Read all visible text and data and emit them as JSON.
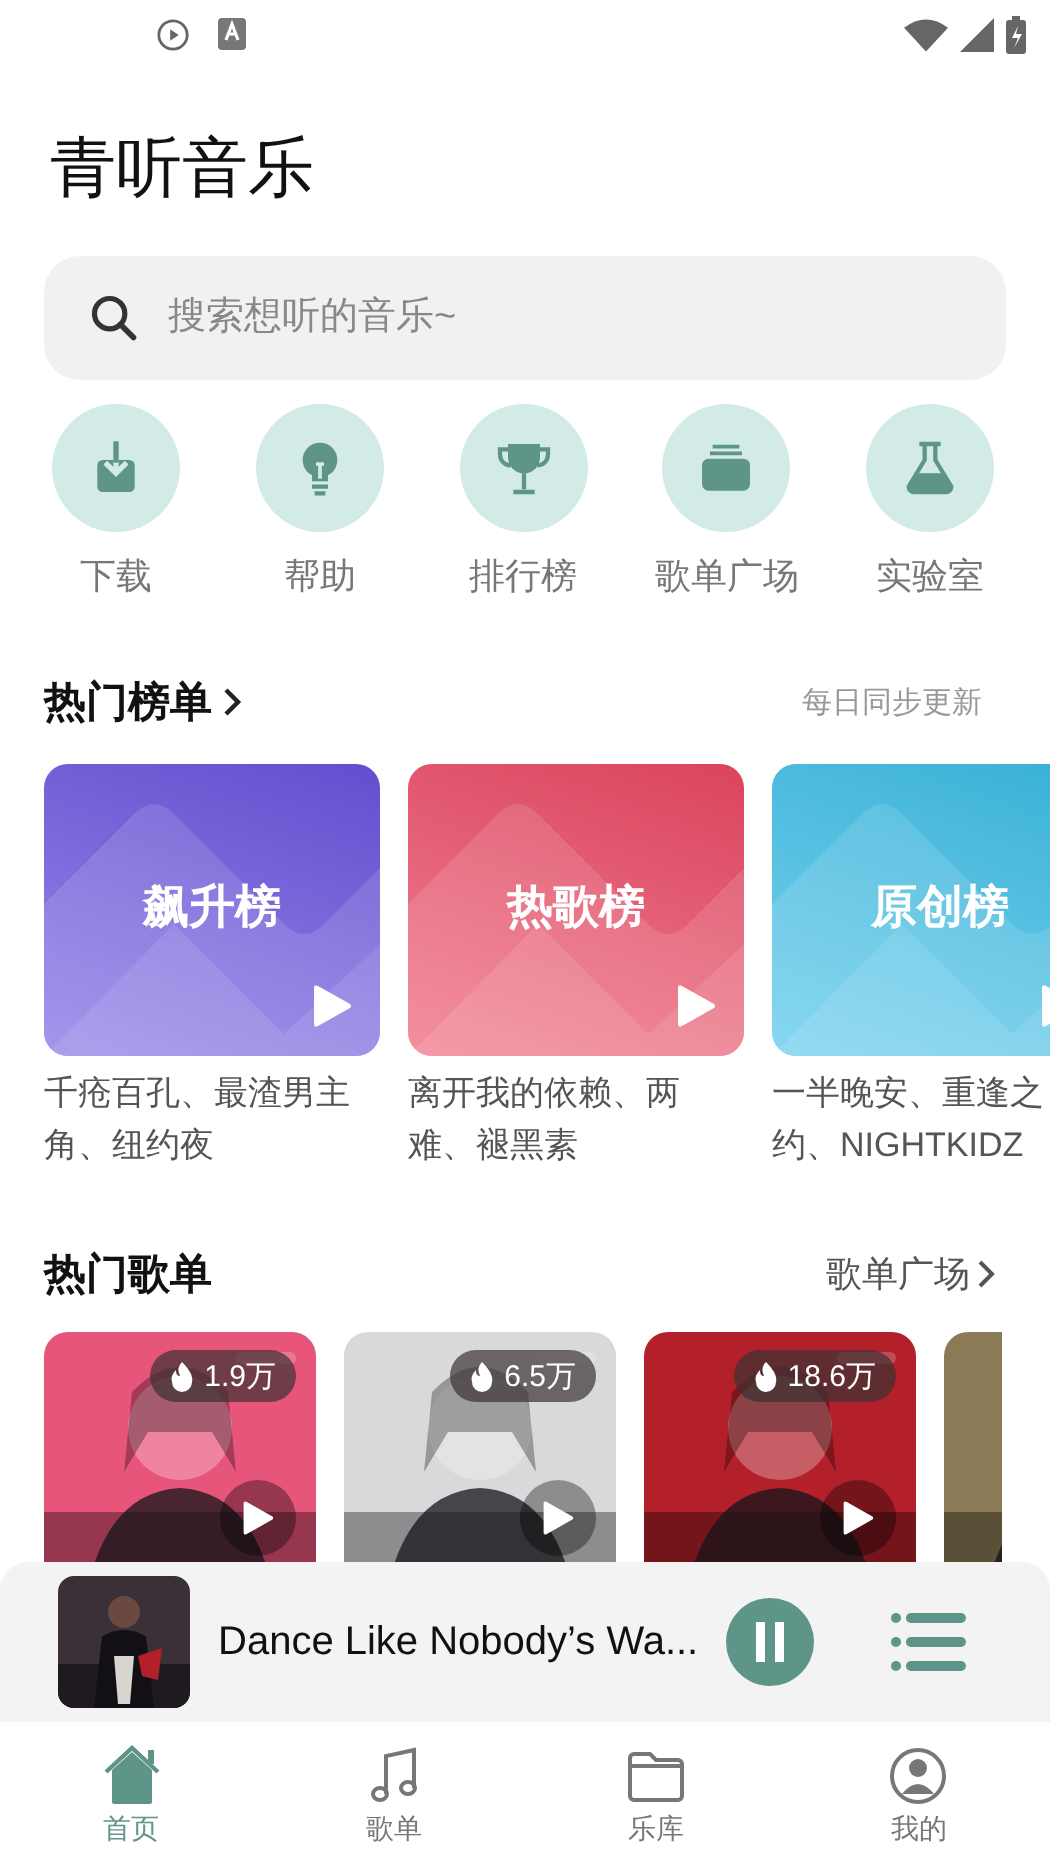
{
  "app_title": "青听音乐",
  "search": {
    "placeholder": "搜索想听的音乐~"
  },
  "shortcuts": [
    {
      "kind": "download",
      "label": "下载"
    },
    {
      "kind": "bulb",
      "label": "帮助"
    },
    {
      "kind": "trophy",
      "label": "排行榜"
    },
    {
      "kind": "stack",
      "label": "歌单广场"
    },
    {
      "kind": "flask",
      "label": "实验室"
    }
  ],
  "charts_section": {
    "title": "热门榜单",
    "note": "每日同步更新",
    "charts": [
      {
        "title": "飙升榜",
        "color": "#6a55e0",
        "tracks": "千疮百孔、最渣男主角、纽约夜"
      },
      {
        "title": "热歌榜",
        "color": "#ec4a64",
        "tracks": "离开我的依赖、两难、褪黑素"
      },
      {
        "title": "原创榜",
        "color": "#3dbfe8",
        "tracks": "一半晚安、重逢之约、NIGHTKIDZ"
      }
    ]
  },
  "playlists_section": {
    "title": "热门歌单",
    "link": "歌单广场",
    "playlists": [
      {
        "plays": "1.9万",
        "color": "#e8557a"
      },
      {
        "plays": "6.5万",
        "color": "#d9d9dc"
      },
      {
        "plays": "18.6万",
        "color": "#b3202a"
      },
      {
        "color": "#8a7a55"
      }
    ]
  },
  "mini_player": {
    "title": "Dance Like Nobody’s Wa..."
  },
  "tabs": [
    {
      "kind": "home",
      "label": "首页",
      "selected": true
    },
    {
      "kind": "note",
      "label": "歌单",
      "selected": false
    },
    {
      "kind": "folder",
      "label": "乐库",
      "selected": false
    },
    {
      "kind": "user",
      "label": "我的",
      "selected": false
    }
  ]
}
